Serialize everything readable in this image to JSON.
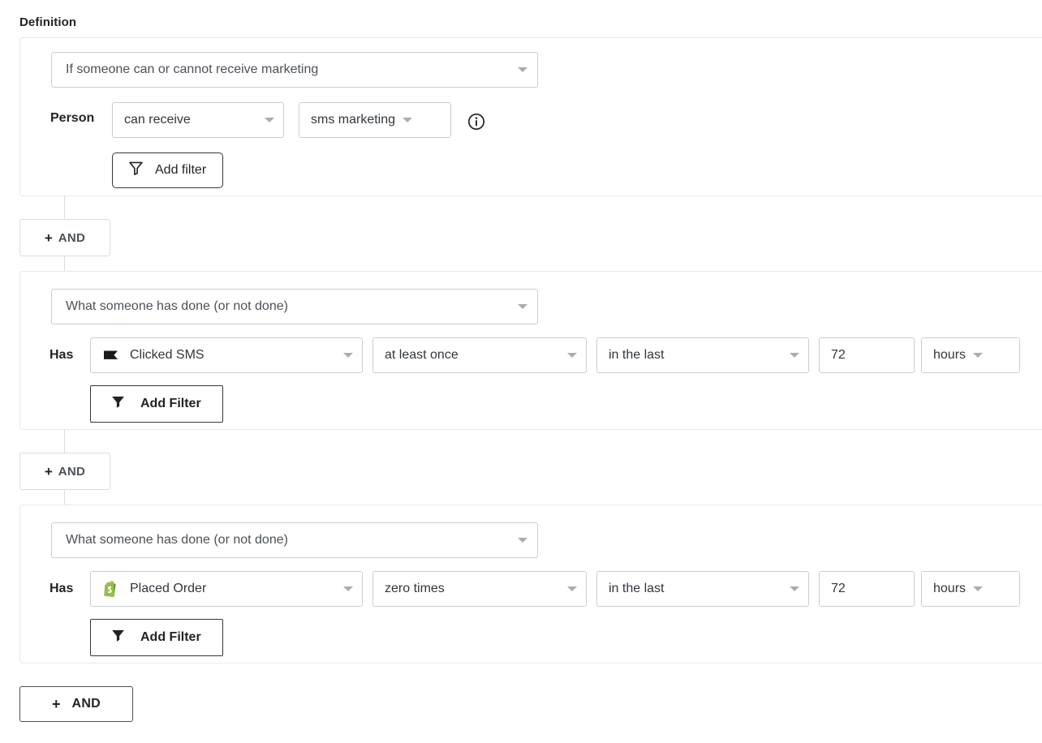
{
  "section": {
    "title": "Definition"
  },
  "colors": {
    "border": "#c9ced3",
    "card_border": "#e6e8eb",
    "text": "#1f2326",
    "muted_text": "#4b5157",
    "caret": "#a7adb3",
    "shopify_green": "#95BF47",
    "sms_black": "#1a1a1a"
  },
  "groups": [
    {
      "type_select": {
        "value": "If someone can or cannot receive marketing",
        "icon": "chevron-down-icon"
      },
      "row_label": "Person",
      "fields": [
        {
          "name": "consent-operator-select",
          "value": "can receive",
          "icon": "chevron-down-icon"
        },
        {
          "name": "consent-channel-select",
          "value": "sms marketing",
          "icon": "chevron-down-icon"
        }
      ],
      "info_icon": "info-circle-icon",
      "add_filter": {
        "label": "Add filter",
        "icon": "filter-outline-icon"
      }
    },
    {
      "type_select": {
        "value": "What someone has done (or not done)",
        "icon": "chevron-down-icon"
      },
      "row_label": "Has",
      "metric": {
        "label": "Clicked SMS",
        "icon": "sms-flag-icon",
        "icon_color": "#1a1a1a"
      },
      "frequency": {
        "value": "at least once",
        "icon": "chevron-down-icon"
      },
      "timeframe": {
        "value": "in the last",
        "icon": "chevron-down-icon"
      },
      "amount": {
        "value": "72"
      },
      "unit": {
        "value": "hours",
        "icon": "chevron-down-icon"
      },
      "add_filter": {
        "label": "Add Filter",
        "icon": "filter-solid-icon"
      }
    },
    {
      "type_select": {
        "value": "What someone has done (or not done)",
        "icon": "chevron-down-icon"
      },
      "row_label": "Has",
      "metric": {
        "label": "Placed Order",
        "icon": "shopify-bag-icon",
        "icon_color": "#95BF47"
      },
      "frequency": {
        "value": "zero times",
        "icon": "chevron-down-icon"
      },
      "timeframe": {
        "value": "in the last",
        "icon": "chevron-down-icon"
      },
      "amount": {
        "value": "72"
      },
      "unit": {
        "value": "hours",
        "icon": "chevron-down-icon"
      },
      "add_filter": {
        "label": "Add Filter",
        "icon": "filter-solid-icon"
      }
    }
  ],
  "and_chips": [
    {
      "plus": "+",
      "label": "AND"
    },
    {
      "plus": "+",
      "label": "AND"
    }
  ],
  "and_button": {
    "plus": "+",
    "label": "AND"
  }
}
